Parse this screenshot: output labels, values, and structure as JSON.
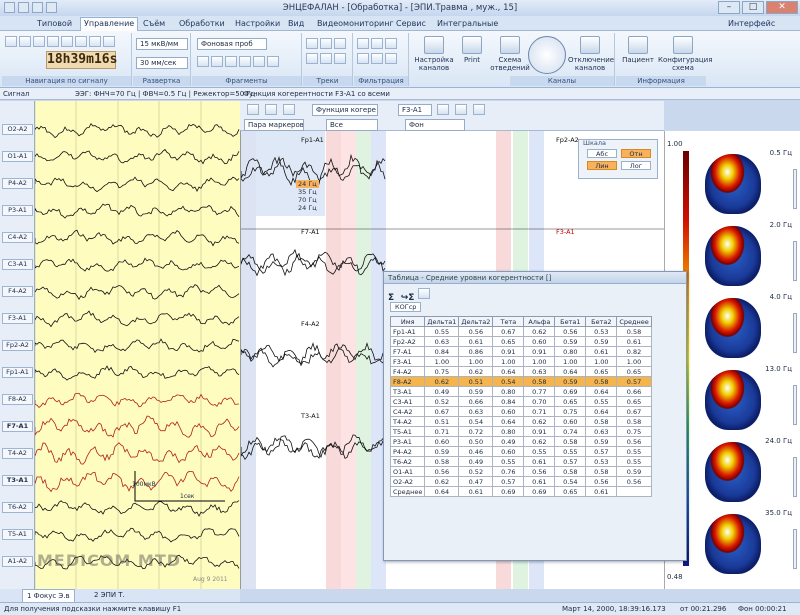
{
  "window": {
    "title": "ЭНЦЕФАЛАН - [Обработка] - [ЭПИ.Травма , муж., 15]",
    "interface_label": "Интерфейс"
  },
  "tabs": [
    "Типовой",
    "Управление",
    "Съём",
    "Обработки",
    "Настройки",
    "Вид",
    "Видеомониторинг",
    "Сервис",
    "Интегральные"
  ],
  "ribbon": {
    "groups": [
      "Навигация по сигналу",
      "Развертка",
      "Фрагменты",
      "Треки",
      "Фильтрация",
      "Каналы",
      "Информация"
    ],
    "sensitivity": "15 мкВ/мм",
    "speed": "30 мм/сек",
    "fragment": "Фоновая проб",
    "time_h": "18",
    "time_m": "39",
    "time_s": "16",
    "buttons": [
      "Настройка каналов",
      "Print",
      "Схема отведений",
      "Отключение каналов",
      "Пациент",
      "Конфигурация схема"
    ]
  },
  "infobar": {
    "signal": "Сигнал",
    "filters": "ЭЭГ: ФНЧ=70 Гц | ФВЧ=0.5 Гц | Режектор=50 Гц",
    "coh_title": "Функция когерентности  F3-A1 со всеми"
  },
  "channels": [
    "O2-A2",
    "O1-A1",
    "P4-A2",
    "P3-A1",
    "C4-A2",
    "C3-A1",
    "F4-A2",
    "F3-A1",
    "Fp2-A2",
    "Fp1-A1",
    "F8-A2",
    "F7-A1",
    "T4-A2",
    "T3-A1",
    "T6-A2",
    "T5-A1",
    "A1-A2"
  ],
  "coh_toolbar": {
    "function": "Функция когере",
    "lead": "F3-A1",
    "markers": "Пара маркеров",
    "all": "Все",
    "bg": "Фон"
  },
  "coh_labels": [
    "Fp1-A1",
    "Fp2-A2",
    "F7-A1",
    "F3-A1",
    "F4-A2",
    "F8-A2",
    "T3-A1",
    "T5-A1"
  ],
  "freq_list": [
    "24 Гц",
    "35 Гц",
    "70 Гц",
    "24 Гц"
  ],
  "scale": {
    "title": "Шкала",
    "abs": "Абс",
    "rel": "Отн",
    "lin": "Лин",
    "log": "Лог"
  },
  "colorbar": {
    "max": "1.00",
    "min": "0.48"
  },
  "freqs": [
    "0.5 Гц",
    "2.0 Гц",
    "4.0 Гц",
    "13.0 Гц",
    "24.0 Гц",
    "35.0 Гц"
  ],
  "calib": {
    "amp": "100мкВ",
    "time": "1сек"
  },
  "watermark": "MEDICOM MTD",
  "date_stamp": "Aug 9 2011",
  "dialog": {
    "title": "Таблица - Средние уровни когерентности []",
    "tab": "КОГср",
    "headers": [
      "Имя",
      "Дельта1",
      "Дельта2",
      "Тета",
      "Альфа",
      "Бета1",
      "Бета2",
      "Среднее"
    ],
    "rows": [
      [
        "Fp1-A1",
        "0.55",
        "0.56",
        "0.67",
        "0.62",
        "0.56",
        "0.53",
        "0.58"
      ],
      [
        "Fp2-A2",
        "0.63",
        "0.61",
        "0.65",
        "0.60",
        "0.59",
        "0.59",
        "0.61"
      ],
      [
        "F7-A1",
        "0.84",
        "0.86",
        "0.91",
        "0.91",
        "0.80",
        "0.61",
        "0.82"
      ],
      [
        "F3-A1",
        "1.00",
        "1.00",
        "1.00",
        "1.00",
        "1.00",
        "1.00",
        "1.00"
      ],
      [
        "F4-A2",
        "0.75",
        "0.62",
        "0.64",
        "0.63",
        "0.64",
        "0.65",
        "0.65"
      ],
      [
        "F8-A2",
        "0.62",
        "0.51",
        "0.54",
        "0.58",
        "0.59",
        "0.58",
        "0.57"
      ],
      [
        "T3-A1",
        "0.49",
        "0.59",
        "0.80",
        "0.77",
        "0.69",
        "0.64",
        "0.66"
      ],
      [
        "C3-A1",
        "0.52",
        "0.66",
        "0.84",
        "0.70",
        "0.65",
        "0.55",
        "0.65"
      ],
      [
        "C4-A2",
        "0.67",
        "0.63",
        "0.60",
        "0.71",
        "0.75",
        "0.64",
        "0.67"
      ],
      [
        "T4-A2",
        "0.51",
        "0.54",
        "0.64",
        "0.62",
        "0.60",
        "0.58",
        "0.58"
      ],
      [
        "T5-A1",
        "0.71",
        "0.72",
        "0.80",
        "0.91",
        "0.74",
        "0.63",
        "0.75"
      ],
      [
        "P3-A1",
        "0.60",
        "0.50",
        "0.49",
        "0.62",
        "0.58",
        "0.59",
        "0.56"
      ],
      [
        "P4-A2",
        "0.59",
        "0.46",
        "0.60",
        "0.55",
        "0.55",
        "0.57",
        "0.55"
      ],
      [
        "T6-A2",
        "0.58",
        "0.49",
        "0.55",
        "0.61",
        "0.57",
        "0.53",
        "0.55"
      ],
      [
        "O1-A1",
        "0.56",
        "0.52",
        "0.76",
        "0.56",
        "0.58",
        "0.58",
        "0.59"
      ],
      [
        "O2-A2",
        "0.62",
        "0.47",
        "0.57",
        "0.61",
        "0.54",
        "0.56",
        "0.56"
      ],
      [
        "Среднее",
        "0.64",
        "0.61",
        "0.69",
        "0.69",
        "0.65",
        "0.61",
        ""
      ]
    ]
  },
  "bottom_tabs": [
    "1 Фокус Э.в",
    "2 ЭПИ Т."
  ],
  "status": {
    "hint": "Для получения подсказки нажмите клавишу F1",
    "datetime": "Март 14, 2000, 18:39:16.173",
    "pos": "от 00:21.296",
    "bg": "Фон 00:00:21"
  }
}
